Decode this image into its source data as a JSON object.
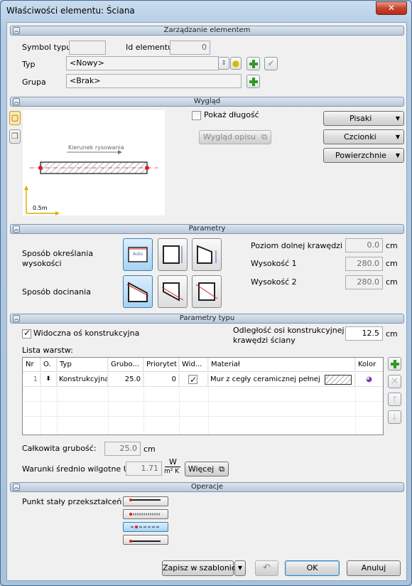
{
  "window": {
    "title": "Właściwości elementu: Ściana",
    "close_glyph": "✕"
  },
  "sections": {
    "management": "Zarządzanie elementem",
    "appearance": "Wygląd",
    "parameters": "Parametry",
    "type_parameters": "Parametry typu",
    "operations": "Operacje"
  },
  "management": {
    "symbol_label": "Symbol typu",
    "symbol_value": "",
    "id_label": "Id elementu",
    "id_value": "0",
    "type_label": "Typ",
    "type_value": "<Nowy>",
    "group_label": "Grupa",
    "group_value": "<Brak>"
  },
  "appearance": {
    "show_length_label": "Pokaż długość",
    "show_length_checked": false,
    "description_button": "Wygląd opisu",
    "pens_button": "Pisaki",
    "fonts_button": "Czcionki",
    "surfaces_button": "Powierzchnie",
    "preview": {
      "direction_label": "Kierunek rysowania",
      "scale_label": "0.5m"
    }
  },
  "parameters": {
    "height_method_label": "Sposób określania wysokości",
    "trim_method_label": "Sposób docinania",
    "auto_label": "Auto",
    "bottom_edge_label": "Poziom dolnej krawędzi",
    "bottom_edge_value": "0.0",
    "bottom_edge_unit": "cm",
    "height1_label": "Wysokość 1",
    "height1_value": "280.0",
    "height1_unit": "cm",
    "height2_label": "Wysokość 2",
    "height2_value": "280.0",
    "height2_unit": "cm"
  },
  "type_params": {
    "visible_axis_label": "Widoczna oś konstrukcyjna",
    "visible_axis_checked": true,
    "axis_distance_label_1": "Odległość osi konstrukcyjnej od",
    "axis_distance_label_2": "krawędzi ściany",
    "axis_distance_value": "12.5",
    "axis_distance_unit": "cm",
    "layer_list_label": "Lista warstw:",
    "columns": [
      "Nr",
      "O.",
      "Typ",
      "Grubo...",
      "Priorytet",
      "Wid...",
      "Materiał",
      "Kolor"
    ],
    "rows": [
      {
        "nr": "1",
        "type": "Konstrukcyjna",
        "thickness": "25.0",
        "priority": "0",
        "visible": true,
        "material": "Mur z cegły ceramicznej pełnej"
      }
    ],
    "total_thickness_label": "Całkowita grubość:",
    "total_thickness_value": "25.0",
    "total_thickness_unit": "cm",
    "humid_label": "Warunki średnio wilgotne U =",
    "humid_value": "1.71",
    "unit_numerator": "W",
    "unit_denominator": "m² K",
    "more_button": "Więcej"
  },
  "operations": {
    "fixed_point_label": "Punkt stały przekształceń"
  },
  "footer": {
    "template_button": "Zapisz w szablonie",
    "ok_button": "OK",
    "cancel_button": "Anuluj"
  },
  "colors": {
    "accent_green": "#2e9a22",
    "selected_blue": "#a8d2f2",
    "axis_red": "#d81e1e"
  }
}
